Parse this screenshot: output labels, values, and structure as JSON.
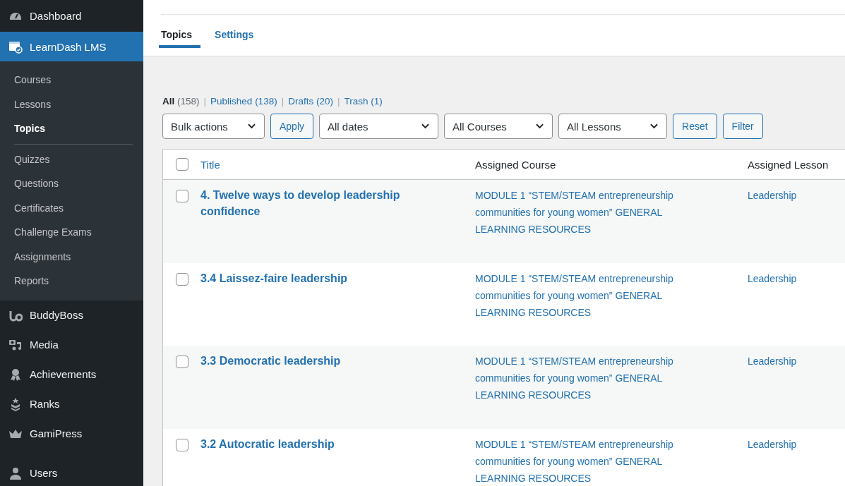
{
  "sidebar": {
    "items": [
      {
        "label": "Dashboard",
        "kind": "menu",
        "selected": false
      },
      {
        "label": "LearnDash LMS",
        "kind": "menu",
        "selected": true,
        "children": [
          {
            "label": "Courses",
            "kind": "item",
            "selected": false
          },
          {
            "label": "Lessons",
            "kind": "item",
            "selected": false
          },
          {
            "label": "Topics",
            "kind": "item",
            "selected": true
          },
          {
            "kind": "divider"
          },
          {
            "label": "Quizzes",
            "kind": "item",
            "selected": false
          },
          {
            "label": "Questions",
            "kind": "item",
            "selected": false
          },
          {
            "label": "Certificates",
            "kind": "item",
            "selected": false
          },
          {
            "label": "Challenge Exams",
            "kind": "item",
            "selected": false
          },
          {
            "label": "Assignments",
            "kind": "item",
            "selected": false
          },
          {
            "label": "Reports",
            "kind": "item",
            "selected": false
          }
        ]
      },
      {
        "label": "BuddyBoss",
        "kind": "menu",
        "selected": false
      },
      {
        "label": "Media",
        "kind": "menu",
        "selected": false
      },
      {
        "label": "Achievements",
        "kind": "menu",
        "selected": false
      },
      {
        "label": "Ranks",
        "kind": "menu",
        "selected": false
      },
      {
        "label": "GamiPress",
        "kind": "menu",
        "selected": false
      },
      {
        "label": "Users",
        "kind": "menu",
        "selected": false
      }
    ]
  },
  "tabs": [
    {
      "label": "Topics",
      "selected": true
    },
    {
      "label": "Settings",
      "selected": false
    }
  ],
  "views": {
    "separator": "|",
    "items": [
      {
        "label": "All",
        "count": "(158)",
        "selected": true
      },
      {
        "label": "Published",
        "count": "(138)",
        "selected": false
      },
      {
        "label": "Drafts",
        "count": "(20)",
        "selected": false
      },
      {
        "label": "Trash",
        "count": "(1)",
        "selected": false
      }
    ]
  },
  "toolbar": [
    {
      "kind": "select",
      "value": "Bulk actions"
    },
    {
      "kind": "button",
      "label": "Apply"
    },
    {
      "kind": "select",
      "value": "All dates"
    },
    {
      "kind": "select",
      "value": "All Courses"
    },
    {
      "kind": "select",
      "value": "All Lessons"
    },
    {
      "kind": "button",
      "label": "Reset"
    },
    {
      "kind": "button",
      "label": "Filter"
    }
  ],
  "table": {
    "select_all_checked": false,
    "columns": [
      {
        "label": "Title",
        "sortable": true
      },
      {
        "label": "Assigned Course",
        "sortable": false
      },
      {
        "label": "Assigned Lesson",
        "sortable": false
      }
    ],
    "rows": [
      {
        "checked": false,
        "title": "4. Twelve ways to develop leadership confidence",
        "course": "MODULE 1 “STEM/STEAM entrepreneurship communities for young women” GENERAL LEARNING RESOURCES",
        "lesson": "Leadership"
      },
      {
        "checked": false,
        "title": "3.4 Laissez-faire leadership",
        "course": "MODULE 1 “STEM/STEAM entrepreneurship communities for young women” GENERAL LEARNING RESOURCES",
        "lesson": "Leadership"
      },
      {
        "checked": false,
        "title": "3.3 Democratic leadership",
        "course": "MODULE 1 “STEM/STEAM entrepreneurship communities for young women” GENERAL LEARNING RESOURCES",
        "lesson": "Leadership"
      },
      {
        "checked": false,
        "title": "3.2 Autocratic leadership",
        "course": "MODULE 1 “STEM/STEAM entrepreneurship communities for young women” GENERAL LEARNING RESOURCES",
        "lesson": "Leadership"
      }
    ]
  }
}
